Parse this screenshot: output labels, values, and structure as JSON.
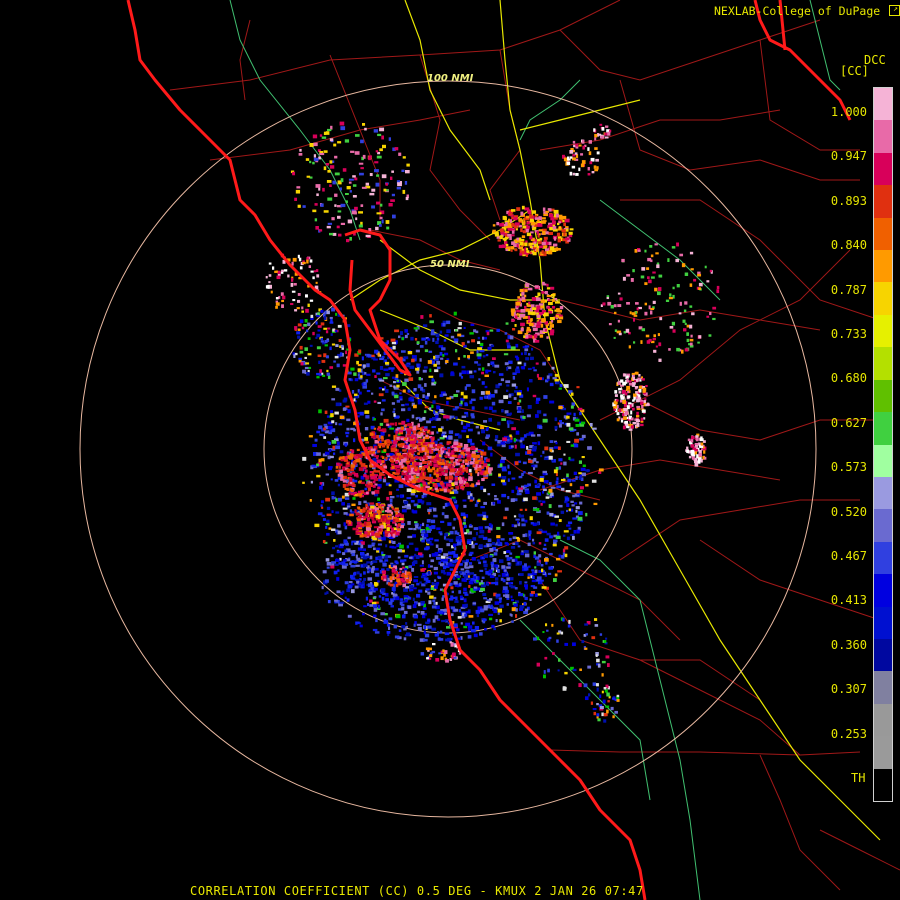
{
  "header": {
    "credit": "NEXLAB-College of DuPage",
    "product_code": "DCC",
    "unit_label": "[CC]"
  },
  "footer": {
    "caption": "CORRELATION COEFFICIENT (CC) 0.5 DEG - KMUX 2 JAN 26 07:47"
  },
  "range_rings": [
    {
      "label": "50 NMI",
      "range_nmi": 50
    },
    {
      "label": "100 NMI",
      "range_nmi": 100
    }
  ],
  "legend": {
    "ticks": [
      "1.000",
      "0.947",
      "0.893",
      "0.840",
      "0.787",
      "0.733",
      "0.680",
      "0.627",
      "0.573",
      "0.520",
      "0.467",
      "0.413",
      "0.360",
      "0.307",
      "0.253"
    ],
    "bottom_label": "TH",
    "color_stops": [
      "#f5b3d6",
      "#e86aa8",
      "#d8005a",
      "#e03010",
      "#f06000",
      "#ff9a00",
      "#f7d400",
      "#e6f000",
      "#b4e000",
      "#60c000",
      "#40d040",
      "#a0ffa0",
      "#9a9ae0",
      "#6a6ad0",
      "#3040e0",
      "#0000e0",
      "#0010d0",
      "#0008a0",
      "#8080a0",
      "#999999",
      "#9a9a9a",
      "#000000"
    ]
  },
  "colors": {
    "coastline": "#ff1a1a",
    "county_lines": "#a01818",
    "highway": "#e8e800",
    "state_roads": "#40c070",
    "range_ring": "#e8b8a0",
    "text": "#e6e600"
  },
  "icons": [
    "external-link-icon"
  ]
}
